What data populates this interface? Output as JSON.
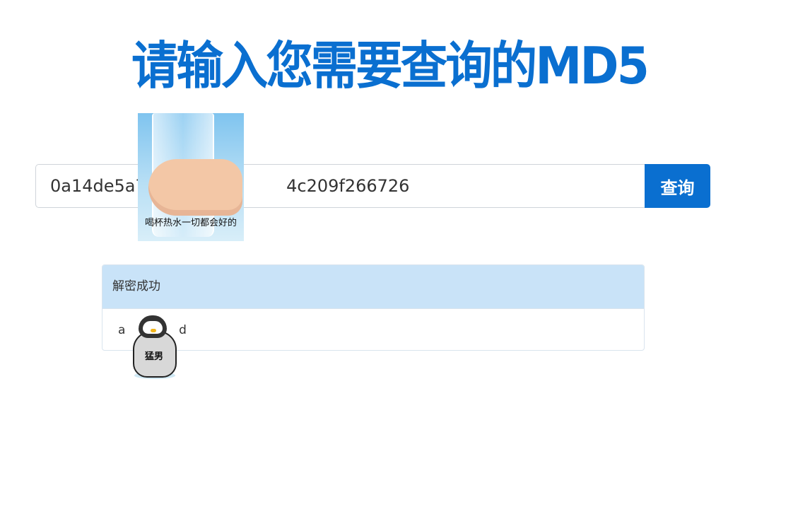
{
  "page": {
    "title": "请输入您需要查询的MD5"
  },
  "search": {
    "value": "0a14de5a7                          4c209f266726",
    "button_label": "查询"
  },
  "result": {
    "heading": "解密成功",
    "body": "a              d"
  },
  "stickers": {
    "water_caption": "喝杯热水一切都会好的",
    "penguin_label": "猛男"
  },
  "colors": {
    "accent": "#0a6fd0",
    "result_heading_bg": "#c9e3f8",
    "text": "#333333"
  }
}
